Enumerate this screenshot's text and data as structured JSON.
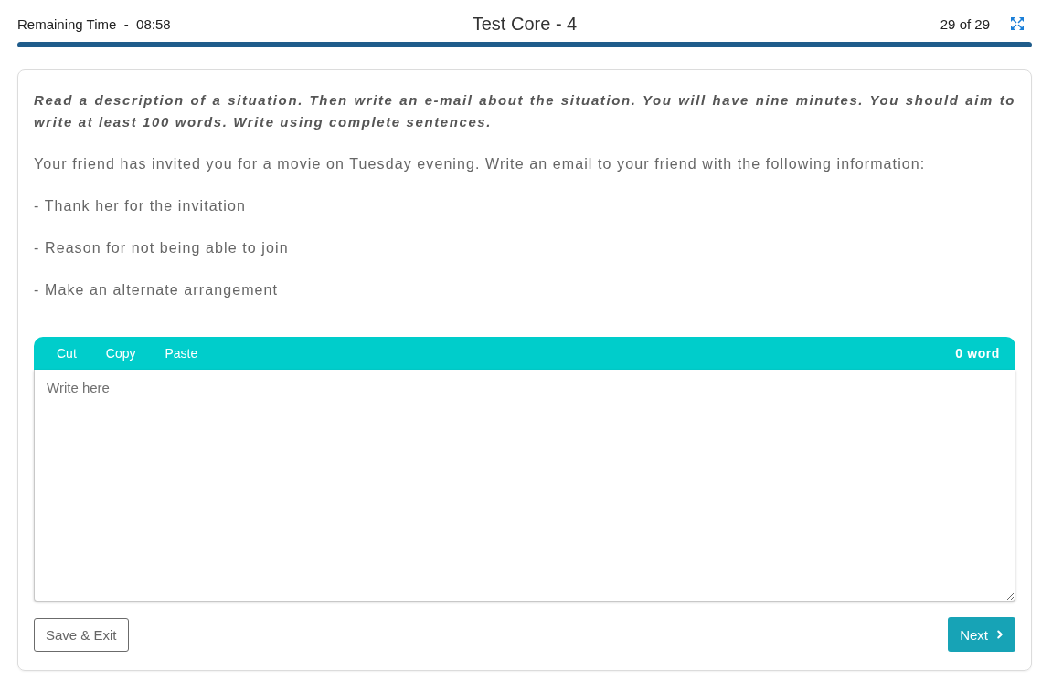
{
  "header": {
    "timer": "Remaining Time  -  08:58",
    "title": "Test Core - 4",
    "position": "29 of 29"
  },
  "progress": {
    "level": 1
  },
  "task": {
    "instructions": "Read a description of a situation. Then write an e-mail about the situation. You will have nine minutes. You should aim to write at least 100 words. Write using complete sentences.",
    "prompt": "Your friend has invited you for a movie on Tuesday evening. Write an email to your friend with the following information:",
    "points": [
      "- Thank her for the invitation",
      "- Reason for not being able to join",
      "- Make an alternate arrangement"
    ]
  },
  "editor": {
    "toolbar": [
      "Cut",
      "Copy",
      "Paste"
    ],
    "word_count": "0 word",
    "placeholder": "Write here"
  },
  "buttons": {
    "save_exit": "Save & Exit",
    "next": "Next"
  }
}
